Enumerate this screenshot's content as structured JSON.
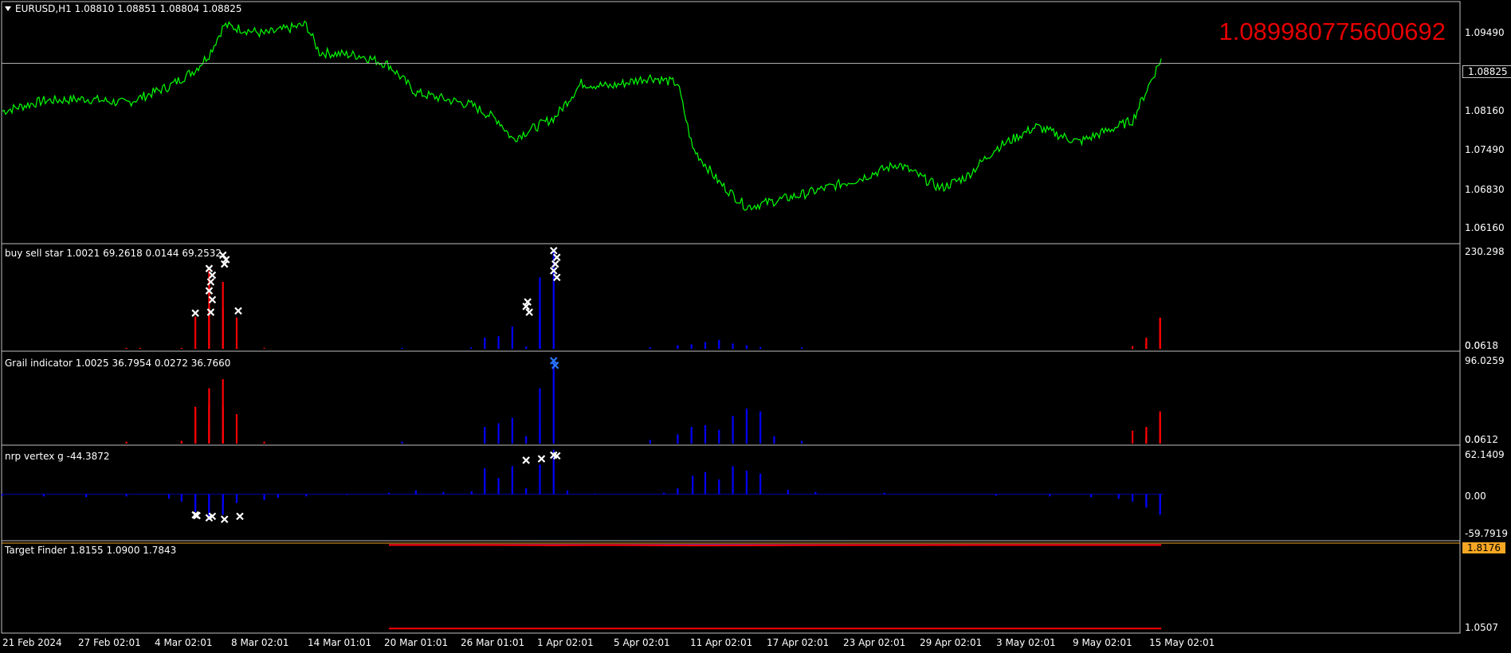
{
  "chart_data": [
    {
      "type": "line",
      "title": "EURUSD,H1  1.08810 1.08851 1.08804 1.08825",
      "y_ticks": [
        "1.09490",
        "1.08160",
        "1.07490",
        "1.06830",
        "1.06160"
      ],
      "ylim": [
        1.0592,
        1.0981
      ],
      "current_price": "1.08825",
      "big_value": "1.089980775600692",
      "line_color": "#00ff00",
      "x_dates": [
        "21 Feb 2024",
        "27 Feb 02:01",
        "4 Mar 02:01",
        "8 Mar 02:01",
        "14 Mar 01:01",
        "20 Mar 01:01",
        "26 Mar 01:01",
        "1 Apr 02:01",
        "5 Apr 02:01",
        "11 Apr 02:01",
        "17 Apr 02:01",
        "23 Apr 02:01",
        "29 Apr 02:01",
        "3 May 02:01",
        "9 May 02:01",
        "15 May 02:01"
      ],
      "series": [
        {
          "x": [
            "21 Feb 2024",
            "24 Feb",
            "27 Feb 02:01",
            "1 Mar",
            "4 Mar 02:01",
            "6 Mar",
            "7 Mar",
            "8 Mar 02:01",
            "11 Mar",
            "14 Mar 01:01",
            "15 Mar",
            "18 Mar",
            "20 Mar 01:01",
            "22 Mar",
            "26 Mar 01:01",
            "28 Mar",
            "29 Mar",
            "1 Apr 02:01",
            "3 Apr",
            "5 Apr 02:01",
            "8 Apr",
            "10 Apr",
            "11 Apr 02:01",
            "13 Apr",
            "15 Apr",
            "17 Apr 02:01",
            "19 Apr",
            "23 Apr 02:01",
            "26 Apr",
            "29 Apr 02:01",
            "1 May",
            "3 May 02:01",
            "6 May",
            "9 May 02:01",
            "13 May",
            "15 May 02:01"
          ],
          "values": [
            1.0805,
            1.0822,
            1.0825,
            1.0818,
            1.0845,
            1.0872,
            1.0897,
            1.0944,
            1.093,
            1.0945,
            1.09,
            1.0895,
            1.088,
            1.0835,
            1.0815,
            1.079,
            1.076,
            1.0795,
            1.085,
            1.0845,
            1.086,
            1.085,
            1.0745,
            1.069,
            1.065,
            1.066,
            1.067,
            1.0695,
            1.072,
            1.068,
            1.07,
            1.0745,
            1.078,
            1.0755,
            1.079,
            1.089
          ]
        }
      ]
    },
    {
      "type": "bar",
      "title": "buy sell star 1.0021 69.2618 0.0144 69.2532",
      "y_ticks": [
        "230.298",
        "0.0618",
        "0.0"
      ],
      "ylim": [
        0,
        230.298
      ],
      "series": [
        {
          "name": "",
          "color": "#ff0000",
          "x": [
            "1 Mar",
            "2 Mar",
            "5 Mar",
            "6 Mar",
            "6 Mar",
            "7 Mar",
            "7 Mar",
            "7 Mar",
            "8 Mar",
            "8 Mar",
            "9 Mar",
            "9 Mar",
            "11 Mar",
            "13 May",
            "14 May",
            "14 May",
            "15 May",
            "15 May",
            "15 May",
            "15 May",
            "15 May",
            "15 May"
          ],
          "values": [
            2,
            2,
            2,
            3,
            72,
            75,
            82,
            175,
            150,
            90,
            70,
            4,
            2,
            6,
            20,
            25,
            30,
            38,
            50,
            62,
            70,
            69
          ]
        },
        {
          "name": "",
          "color": "#0000ff",
          "x": [
            "21 Mar",
            "26 Mar",
            "27 Mar",
            "28 Mar",
            "29 Mar",
            "30 Mar",
            "30 Mar",
            "31 Mar",
            "31 Mar",
            "31 Mar",
            "1 Apr",
            "1 Apr",
            "8 Apr",
            "10 Apr",
            "11 Apr",
            "12 Apr",
            "13 Apr",
            "14 Apr",
            "15 Apr",
            "16 Apr",
            "19 Apr"
          ],
          "values": [
            2,
            3,
            25,
            28,
            50,
            5,
            3,
            70,
            80,
            160,
            220,
            5,
            4,
            8,
            10,
            15,
            20,
            12,
            8,
            4,
            3
          ]
        }
      ],
      "markers_x": [
        "6 Mar",
        "7 Mar",
        "7 Mar",
        "7 Mar",
        "7 Mar",
        "7 Mar",
        "7 Mar",
        "8 Mar",
        "8 Mar",
        "8 Mar",
        "9 Mar",
        "30 Mar",
        "30 Mar",
        "30 Mar",
        "1 Apr",
        "1 Apr",
        "1 Apr",
        "1 Apr",
        "1 Apr"
      ],
      "markers_y": [
        80,
        82,
        110,
        130,
        150,
        165,
        180,
        190,
        200,
        210,
        85,
        82,
        95,
        105,
        160,
        175,
        190,
        205,
        220
      ],
      "marker_color": "#ffffff"
    },
    {
      "type": "bar",
      "title": "Grail indicator 1.0025 36.7954 0.0272 36.7660",
      "y_ticks": [
        "96.0259",
        "0.0612",
        "0.0"
      ],
      "ylim": [
        0,
        96.0259
      ],
      "series": [
        {
          "name": "",
          "color": "#ff0000",
          "x": [
            "1 Mar",
            "5 Mar",
            "6 Mar",
            "6 Mar",
            "6 Mar",
            "7 Mar",
            "7 Mar",
            "7 Mar",
            "8 Mar",
            "8 Mar",
            "8 Mar",
            "9 Mar",
            "11 Mar",
            "13 May",
            "14 May",
            "14 May",
            "15 May",
            "15 May",
            "15 May",
            "15 May"
          ],
          "values": [
            2,
            3,
            28,
            38,
            40,
            20,
            42,
            60,
            70,
            40,
            15,
            32,
            2,
            14,
            10,
            18,
            20,
            28,
            32,
            35
          ]
        },
        {
          "name": "",
          "color": "#0000ff",
          "x": [
            "21 Mar",
            "27 Mar",
            "28 Mar",
            "29 Mar",
            "30 Mar",
            "31 Mar",
            "31 Mar",
            "1 Apr",
            "8 Apr",
            "10 Apr",
            "11 Apr",
            "12 Apr",
            "13 Apr",
            "14 Apr",
            "15 Apr",
            "16 Apr",
            "17 Apr",
            "19 Apr"
          ],
          "values": [
            2,
            18,
            22,
            28,
            8,
            60,
            20,
            90,
            4,
            10,
            18,
            20,
            15,
            30,
            38,
            35,
            8,
            3
          ]
        }
      ],
      "markers_x": [
        "1 Apr",
        "1 Apr"
      ],
      "markers_y": [
        90,
        85
      ],
      "marker_color": "#2a78ff"
    },
    {
      "type": "bar",
      "title": "nrp vertex g -44.3872",
      "y_ticks": [
        "62.1409",
        "0.00",
        "-59.7919"
      ],
      "ylim": [
        -59.7919,
        62.1409
      ],
      "series": [
        {
          "name": "",
          "color": "#0000ff",
          "x": [
            "21 Feb 2024",
            "24 Feb",
            "27 Feb 02:01",
            "1 Mar",
            "4 Mar 02:01",
            "5 Mar",
            "6 Mar",
            "6 Mar",
            "7 Mar",
            "7 Mar",
            "8 Mar",
            "8 Mar",
            "9 Mar",
            "11 Mar",
            "12 Mar",
            "14 Mar 01:01",
            "17 Mar",
            "20 Mar 01:01",
            "22 Mar",
            "24 Mar",
            "26 Mar 01:01",
            "27 Mar",
            "28 Mar",
            "29 Mar",
            "30 Mar",
            "31 Mar",
            "1 Apr",
            "2 Apr",
            "4 Apr",
            "7 Apr",
            "9 Apr",
            "10 Apr",
            "11 Apr 02:01",
            "12 Apr",
            "13 Apr",
            "14 Apr",
            "15 Apr",
            "16 Apr",
            "18 Apr",
            "20 Apr",
            "25 Apr",
            "3 May 02:01",
            "7 May",
            "10 May",
            "12 May",
            "13 May",
            "14 May",
            "14 May",
            "15 May",
            "15 May"
          ],
          "values": [
            -2,
            -3,
            -4,
            -3,
            -6,
            -10,
            -18,
            -24,
            -30,
            -35,
            -28,
            -15,
            -12,
            -8,
            -5,
            -3,
            -1,
            2,
            5,
            3,
            4,
            35,
            22,
            38,
            8,
            40,
            60,
            5,
            1,
            0,
            2,
            8,
            25,
            30,
            20,
            38,
            32,
            28,
            6,
            3,
            2,
            -2,
            -3,
            -4,
            -6,
            -10,
            -14,
            -18,
            -22,
            -28
          ]
        }
      ],
      "markers_x": [
        "6 Mar",
        "6 Mar",
        "7 Mar",
        "7 Mar",
        "8 Mar",
        "9 Mar",
        "30 Mar",
        "31 Mar",
        "1 Apr",
        "1 Apr"
      ],
      "markers_y": [
        -28,
        -29,
        -30,
        -32,
        -34,
        -30,
        46,
        48,
        52,
        53
      ],
      "marker_color": "#ffffff"
    },
    {
      "type": "line",
      "title": "Target Finder 1.8155 1.0900 1.7843",
      "y_ticks": [
        "1.8176",
        "1.0507"
      ],
      "ylim": [
        1.0507,
        1.8176
      ],
      "current_value": "1.8176",
      "series": [
        {
          "name": "",
          "color": "#9932cc",
          "x": [
            "20 Mar 01:01",
            "15 May 02:01"
          ],
          "values": [
            1.8155,
            1.8155
          ]
        },
        {
          "name": "",
          "color": "#ff0000",
          "x": [
            "20 Mar 01:01",
            "26 Mar 01:01",
            "1 Apr 02:01",
            "5 Apr 02:01",
            "11 Apr 02:01",
            "17 Apr 02:01",
            "23 Apr 02:01",
            "3 May 02:01",
            "15 May 02:01"
          ],
          "values": [
            1.815,
            1.8148,
            1.813,
            1.814,
            1.8105,
            1.8125,
            1.814,
            1.8145,
            1.815
          ]
        },
        {
          "name": "",
          "color": "#ff0000",
          "x": [
            "20 Mar 01:01",
            "15 May 02:01"
          ],
          "values": [
            1.09,
            1.09
          ]
        }
      ]
    }
  ]
}
